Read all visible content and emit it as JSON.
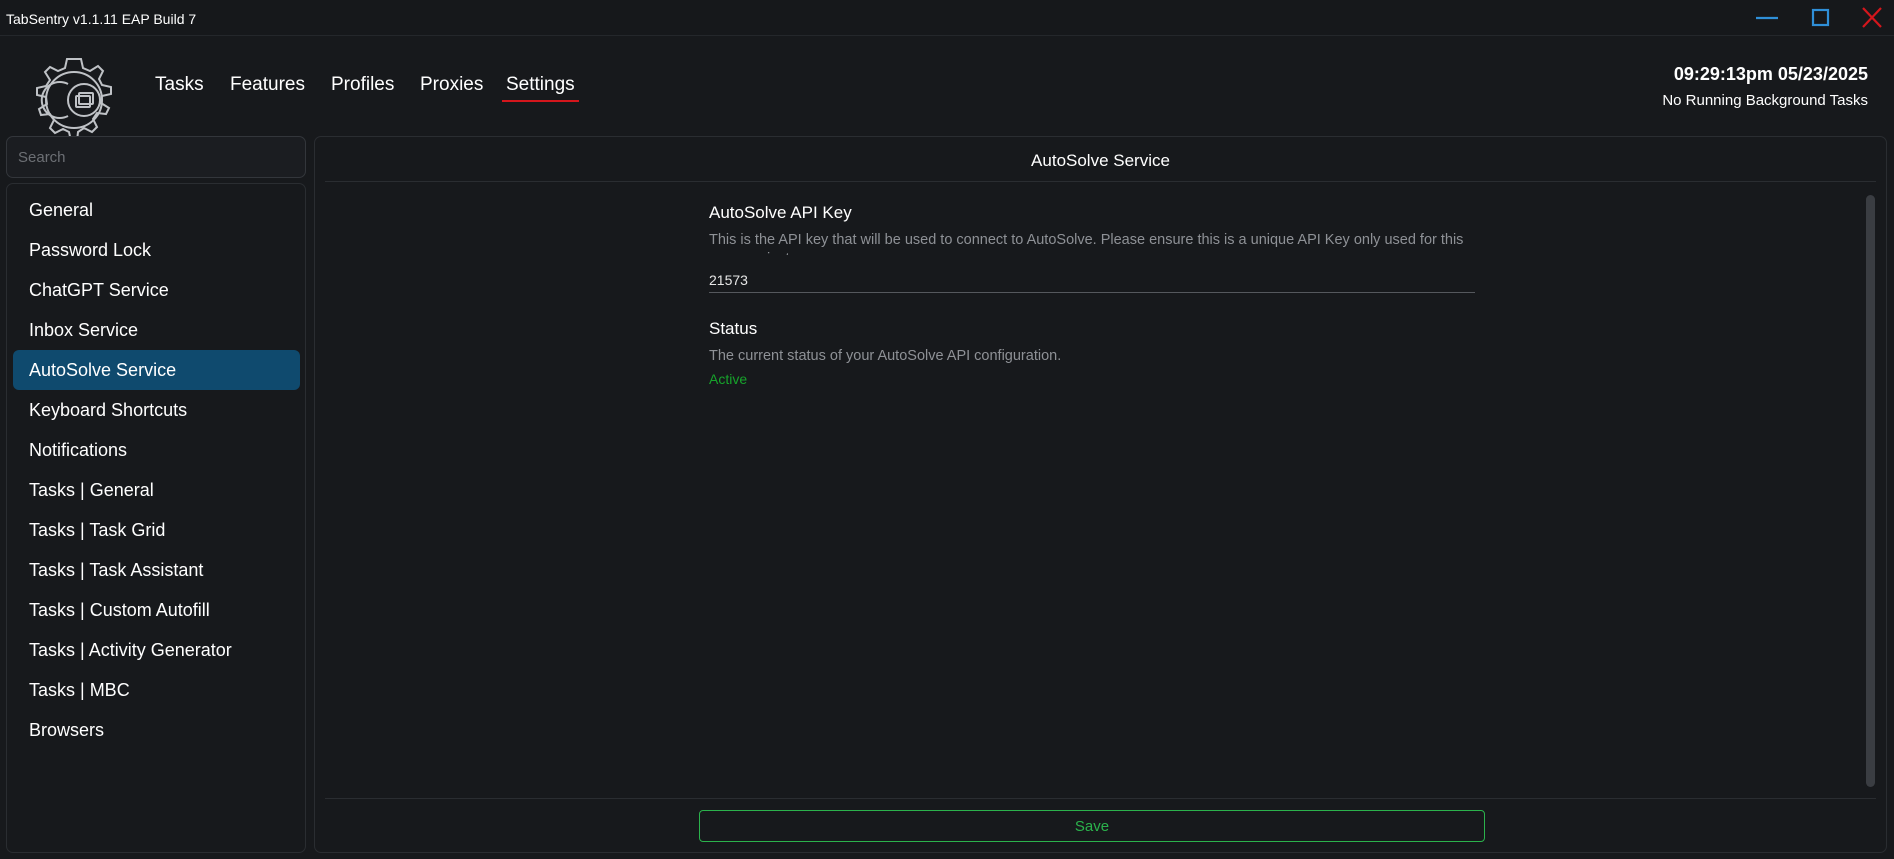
{
  "window": {
    "title": "TabSentry v1.1.11 EAP Build 7",
    "controls": [
      "minimize-icon",
      "maximize-icon",
      "close-icon"
    ],
    "control_colors": {
      "minimize": "#2f8fd8",
      "maximize": "#2f8fd8",
      "close": "#d4161c"
    }
  },
  "nav": {
    "items": [
      "Tasks",
      "Features",
      "Profiles",
      "Proxies",
      "Settings"
    ],
    "active": "Settings",
    "active_underline_color": "#d4161c"
  },
  "header": {
    "clock": "09:29:13pm 05/23/2025",
    "background_status": "No Running Background Tasks"
  },
  "sidebar": {
    "search_placeholder": "Search",
    "items": [
      {
        "label": "General"
      },
      {
        "label": "Password Lock"
      },
      {
        "label": "ChatGPT Service"
      },
      {
        "label": "Inbox Service"
      },
      {
        "label": "AutoSolve Service"
      },
      {
        "label": "Keyboard Shortcuts"
      },
      {
        "label": "Notifications"
      },
      {
        "label": "Tasks | General"
      },
      {
        "label": "Tasks | Task Grid"
      },
      {
        "label": "Tasks | Task Assistant"
      },
      {
        "label": "Tasks | Custom Autofill"
      },
      {
        "label": "Tasks | Activity Generator"
      },
      {
        "label": "Tasks | MBC"
      },
      {
        "label": "Browsers"
      }
    ],
    "active": "AutoSolve Service",
    "active_color": "#0f4a6e"
  },
  "main": {
    "title": "AutoSolve Service",
    "api_key": {
      "label": "AutoSolve API Key",
      "description": "This is the API key that will be used to connect to AutoSolve. Please ensure this is a unique API Key only used for this program instance.",
      "value": "21573"
    },
    "status": {
      "label": "Status",
      "description": "The current status of your AutoSolve API configuration.",
      "value": "Active",
      "value_color": "#17a32b"
    },
    "save_label": "Save",
    "save_color": "#2bb24c"
  }
}
